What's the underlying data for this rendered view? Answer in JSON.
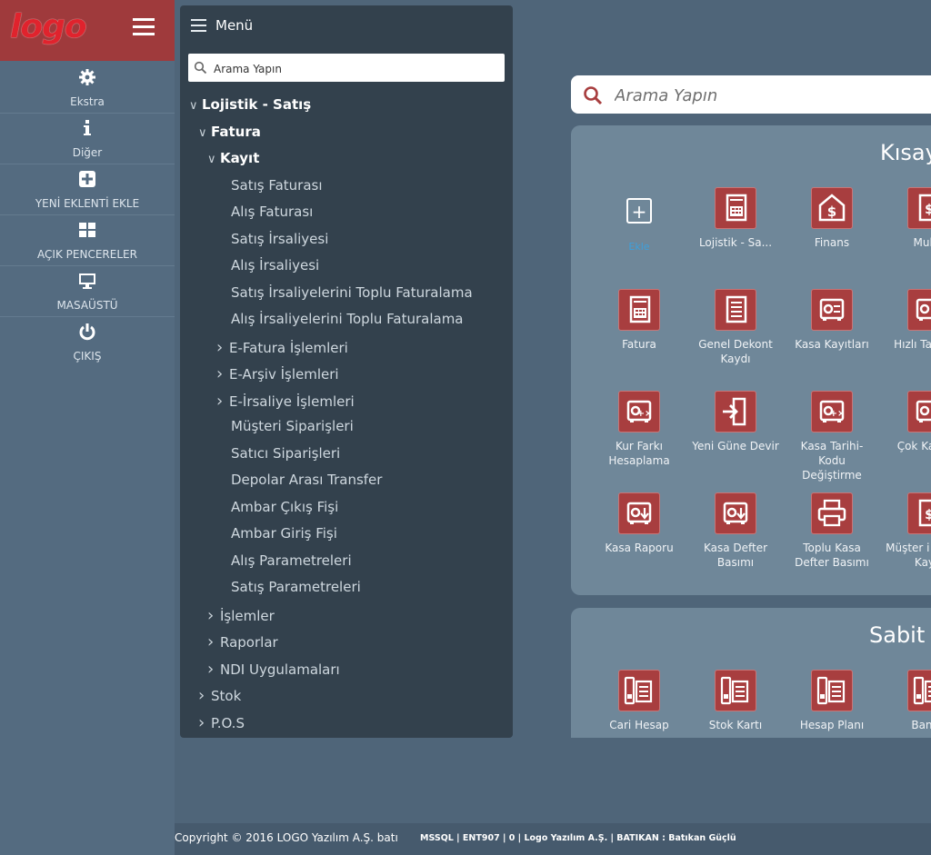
{
  "brand": {
    "logo_text": "logo",
    "accent": "#a83e3f",
    "logo_color": "#e0232d"
  },
  "sidebar": {
    "items": [
      {
        "label": "Ekstra",
        "icon": "gear-icon"
      },
      {
        "label": "Diğer",
        "icon": "info-icon"
      },
      {
        "label": "YENİ EKLENTİ EKLE",
        "icon": "plus-square-icon"
      },
      {
        "label": "AÇIK PENCERELER",
        "icon": "windows-grid-icon"
      },
      {
        "label": "MASAÜSTÜ",
        "icon": "monitor-icon"
      },
      {
        "label": "ÇIKIŞ",
        "icon": "power-icon"
      }
    ]
  },
  "menu": {
    "title": "Menü",
    "search_placeholder": "Arama Yapın",
    "tree": [
      {
        "label": "Lojistik - Satış",
        "state": "expanded",
        "level": 0
      },
      {
        "label": "Fatura",
        "state": "expanded",
        "level": 1
      },
      {
        "label": "Kayıt",
        "state": "expanded",
        "level": 2
      },
      {
        "label": "Satış Faturası",
        "state": "leaf",
        "level": 3
      },
      {
        "label": "Alış Faturası",
        "state": "leaf",
        "level": 3
      },
      {
        "label": "Satış İrsaliyesi",
        "state": "leaf",
        "level": 3
      },
      {
        "label": "Alış İrsaliyesi",
        "state": "leaf",
        "level": 3
      },
      {
        "label": "Satış İrsaliyelerini Toplu Faturalama",
        "state": "leaf",
        "level": 3
      },
      {
        "label": "Alış İrsaliyelerini Toplu Faturalama",
        "state": "leaf",
        "level": 3
      },
      {
        "label": "E-Fatura İşlemleri",
        "state": "collapsed",
        "level": 3
      },
      {
        "label": "E-Arşiv İşlemleri",
        "state": "collapsed",
        "level": 3
      },
      {
        "label": "E-İrsaliye İşlemleri",
        "state": "collapsed",
        "level": 3
      },
      {
        "label": "Müşteri Siparişleri",
        "state": "leaf",
        "level": 3
      },
      {
        "label": "Satıcı Siparişleri",
        "state": "leaf",
        "level": 3
      },
      {
        "label": "Depolar Arası Transfer",
        "state": "leaf",
        "level": 3
      },
      {
        "label": "Ambar Çıkış Fişi",
        "state": "leaf",
        "level": 3
      },
      {
        "label": "Ambar Giriş Fişi",
        "state": "leaf",
        "level": 3
      },
      {
        "label": "Alış Parametreleri",
        "state": "leaf",
        "level": 3
      },
      {
        "label": "Satış Parametreleri",
        "state": "leaf",
        "level": 3
      },
      {
        "label": "İşlemler",
        "state": "collapsed",
        "level": 2
      },
      {
        "label": "Raporlar",
        "state": "collapsed",
        "level": 2
      },
      {
        "label": "NDI Uygulamaları",
        "state": "collapsed",
        "level": 2
      },
      {
        "label": "Stok",
        "state": "collapsed",
        "level": 1
      },
      {
        "label": "P.O.S",
        "state": "collapsed",
        "level": 1
      }
    ]
  },
  "main": {
    "search_placeholder": "Arama Yapın",
    "shortcuts_title": "Kısayo",
    "add_label": "Ekle",
    "shortcuts": [
      {
        "label": "Lojistik - Sa...",
        "icon": "invoice-calculator-icon"
      },
      {
        "label": "Finans",
        "icon": "dollar-house-icon"
      },
      {
        "label": "Muha",
        "icon": "ledger-icon"
      },
      {
        "label": "Fatura",
        "icon": "invoice-icon"
      },
      {
        "label": "Genel Dekont Kaydı",
        "icon": "document-lines-icon"
      },
      {
        "label": "Kasa Kayıtları",
        "icon": "safe-transfer-icon"
      },
      {
        "label": "Hızlı Ta Kayıt",
        "icon": "safe-icon"
      },
      {
        "label": "Kur Farkı Hesaplama",
        "icon": "safe-calc-icon"
      },
      {
        "label": "Yeni Güne Devir",
        "icon": "enter-door-icon"
      },
      {
        "label": "Kasa Tarihi-Kodu Değiştirme",
        "icon": "safe-calc-icon"
      },
      {
        "label": "Çok Ka Geç",
        "icon": "safe-icon"
      },
      {
        "label": "Kasa Raporu",
        "icon": "safe-down-icon"
      },
      {
        "label": "Kasa Defter Basımı",
        "icon": "safe-down-icon"
      },
      {
        "label": "Toplu Kasa Defter Basımı",
        "icon": "printer-icon"
      },
      {
        "label": "Müşter i Havale Kayıt",
        "icon": "dollar-doc-icon"
      }
    ],
    "fixed_title": "Sabit T",
    "fixed": [
      {
        "label": "Cari Hesap",
        "icon": "binder-calc-icon"
      },
      {
        "label": "Stok Kartı",
        "icon": "binder-cart-icon"
      },
      {
        "label": "Hesap Planı",
        "icon": "binder-edit-icon"
      },
      {
        "label": "Banka",
        "icon": "binder-bank-icon"
      }
    ]
  },
  "footer": {
    "copyright": "Copyright © 2016 LOGO Yazılım A.Ş. batı",
    "info": "MSSQL | ENT907 | 0 | Logo Yazılım A.Ş. | BATIKAN : Batıkan Güçlü"
  }
}
